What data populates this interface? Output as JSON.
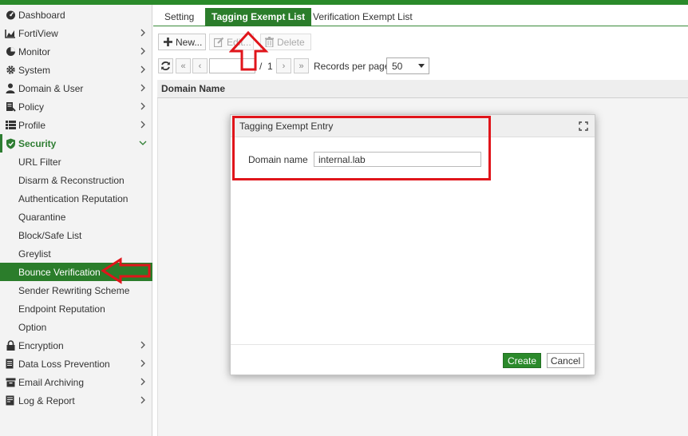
{
  "colors": {
    "brand_green": "#2b7d2b",
    "annotation_red": "#e0151b"
  },
  "sidebar": {
    "items": [
      {
        "label": "Dashboard",
        "icon": "dashboard-icon",
        "chevron": false
      },
      {
        "label": "FortiView",
        "icon": "chart-icon",
        "chevron": true
      },
      {
        "label": "Monitor",
        "icon": "pie-icon",
        "chevron": true
      },
      {
        "label": "System",
        "icon": "gear-icon",
        "chevron": true
      },
      {
        "label": "Domain & User",
        "icon": "user-icon",
        "chevron": true
      },
      {
        "label": "Policy",
        "icon": "policy-icon",
        "chevron": true
      },
      {
        "label": "Profile",
        "icon": "list-icon",
        "chevron": true
      },
      {
        "label": "Security",
        "icon": "shield-icon",
        "chevron": "down"
      },
      {
        "label": "URL Filter"
      },
      {
        "label": "Disarm & Reconstruction"
      },
      {
        "label": "Authentication Reputation"
      },
      {
        "label": "Quarantine"
      },
      {
        "label": "Block/Safe List"
      },
      {
        "label": "Greylist"
      },
      {
        "label": "Bounce Verification",
        "active": true
      },
      {
        "label": "Sender Rewriting Scheme"
      },
      {
        "label": "Endpoint Reputation"
      },
      {
        "label": "Option"
      },
      {
        "label": "Encryption",
        "icon": "lock-icon",
        "chevron": true
      },
      {
        "label": "Data Loss Prevention",
        "icon": "document-icon",
        "chevron": true
      },
      {
        "label": "Email Archiving",
        "icon": "archive-icon",
        "chevron": true
      },
      {
        "label": "Log & Report",
        "icon": "report-icon",
        "chevron": true
      }
    ]
  },
  "tabs": [
    {
      "label": "Setting"
    },
    {
      "label": "Tagging Exempt List",
      "active": true
    },
    {
      "label": "Verification Exempt List"
    }
  ],
  "toolbar": {
    "new_label": "New...",
    "edit_label": "Edit...",
    "delete_label": "Delete"
  },
  "pager": {
    "current_page": "",
    "page_separator": "/",
    "total_pages": "1",
    "records_label": "Records per page",
    "records_value": "50"
  },
  "grid": {
    "columns": [
      "Domain Name"
    ]
  },
  "dialog": {
    "title": "Tagging Exempt Entry",
    "field_label": "Domain name",
    "field_value": "internal.lab",
    "create_label": "Create",
    "cancel_label": "Cancel"
  }
}
